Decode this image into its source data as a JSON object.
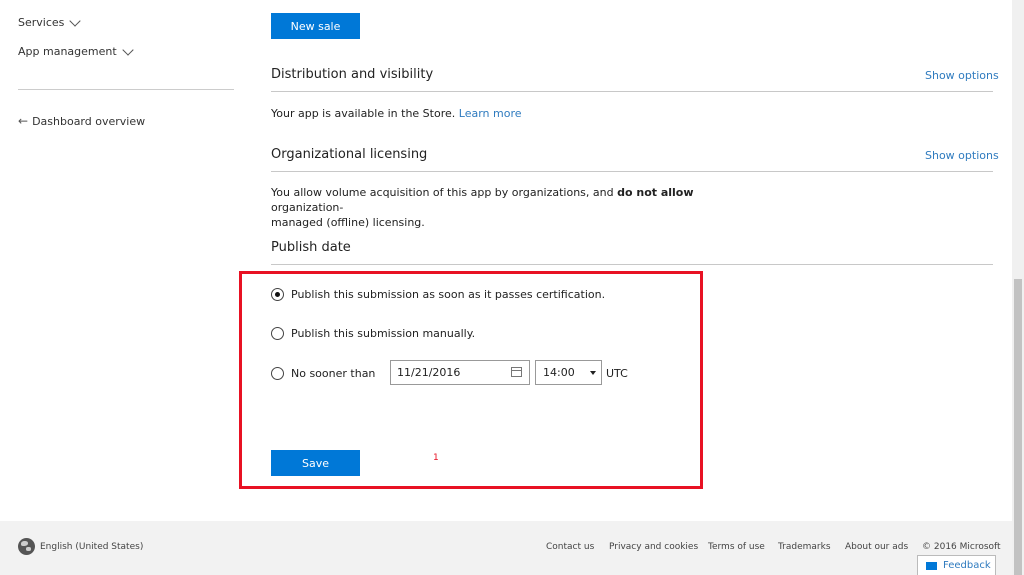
{
  "sidebar": {
    "services": "Services",
    "app_management": "App management",
    "dashboard_overview": "Dashboard overview"
  },
  "main": {
    "new_sale_button": "New sale",
    "distribution": {
      "title": "Distribution and visibility",
      "show_options": "Show options",
      "text": "Your app is available in the Store.",
      "learn_more": "Learn more"
    },
    "org_licensing": {
      "title": "Organizational licensing",
      "show_options": "Show options",
      "text_a": "You allow volume acquisition of this app by organizations, and",
      "text_bold": "do not allow",
      "text_b": "organization-",
      "text_c": "managed (offline) licensing."
    },
    "publish_date": {
      "title": "Publish date",
      "option_asap": "Publish this submission as soon as it passes certification.",
      "option_manual": "Publish this submission manually.",
      "option_no_sooner": "No sooner than",
      "date_value": "11/21/2016",
      "time_value": "14:00",
      "tz": "UTC",
      "selected": "asap"
    },
    "save_button": "Save",
    "annotation": "1"
  },
  "footer": {
    "language": "English (United States)",
    "links": [
      "Contact us",
      "Privacy and cookies",
      "Terms of use",
      "Trademarks",
      "About our ads"
    ],
    "copyright": "© 2016 Microsoft",
    "feedback": "Feedback"
  },
  "colors": {
    "accent": "#0078d7",
    "link": "#2f7bbf",
    "highlight_box": "#e81123"
  }
}
